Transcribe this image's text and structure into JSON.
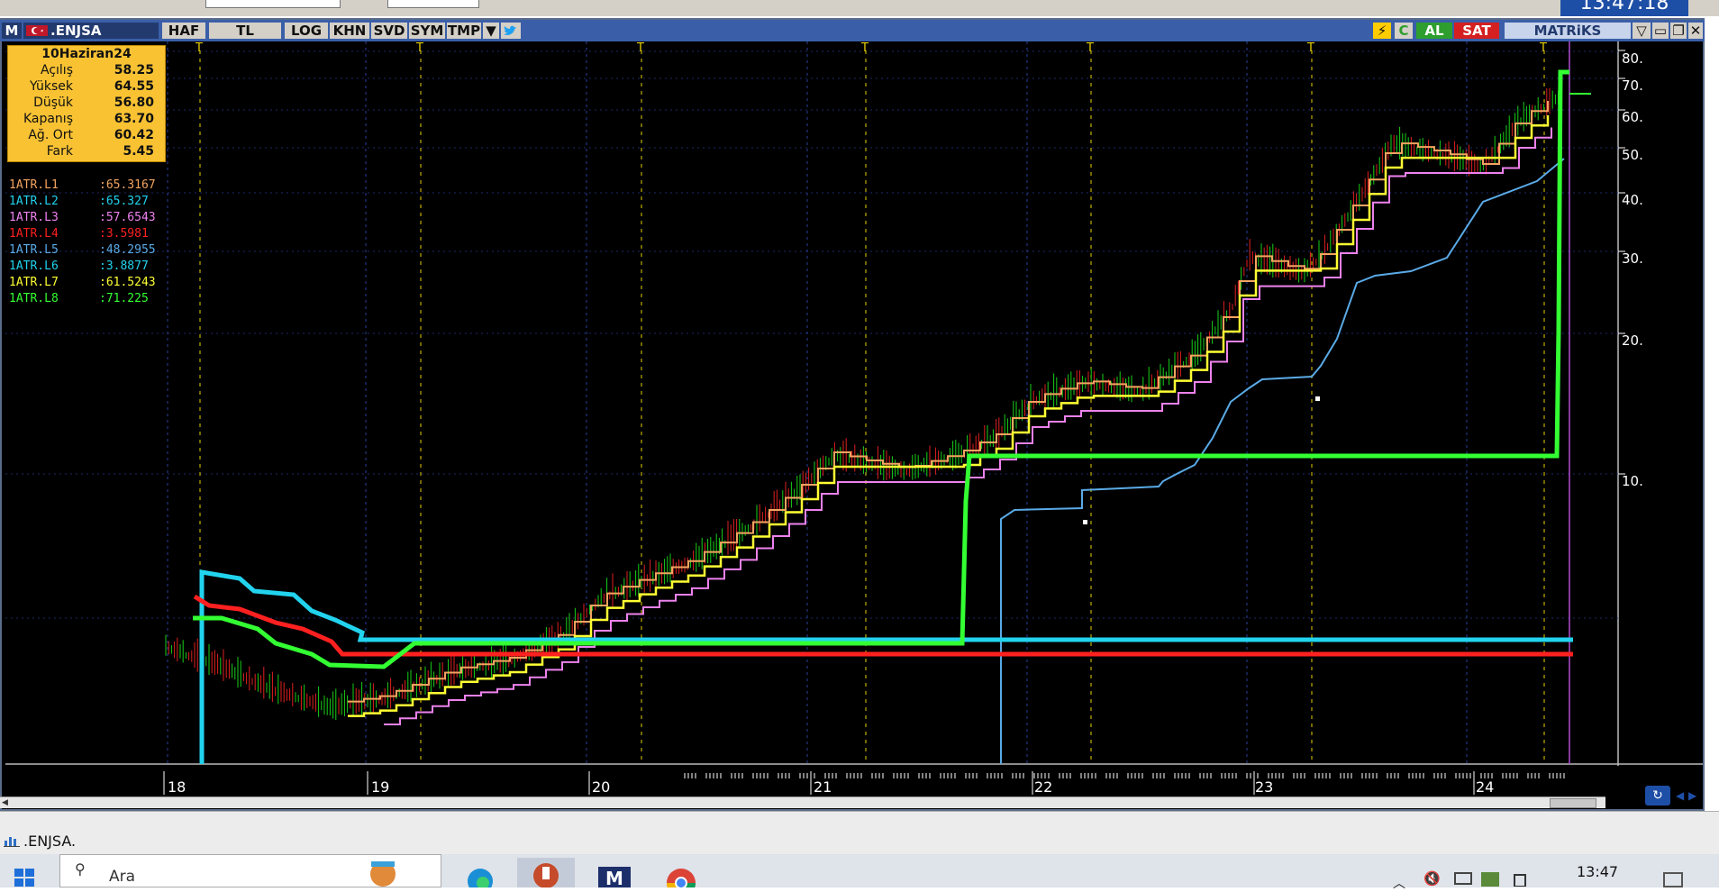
{
  "top_clock": "13:47:18",
  "window": {
    "symbol": ".ENJSA",
    "toolbar": [
      "HAF",
      "TL",
      "LOG",
      "KHN",
      "SVD",
      "SYM",
      "TMP"
    ],
    "al_label": "AL",
    "sat_label": "SAT",
    "brand": "MATRiKS",
    "c_label": "C"
  },
  "ohlc": {
    "date": "10Haziran24",
    "rows": [
      {
        "label": "Açılış",
        "value": "58.25"
      },
      {
        "label": "Yüksek",
        "value": "64.55"
      },
      {
        "label": "Düşük",
        "value": "56.80"
      },
      {
        "label": "Kapanış",
        "value": "63.70"
      },
      {
        "label": "Ağ. Ort",
        "value": "60.42"
      },
      {
        "label": "Fark",
        "value": "5.45"
      }
    ]
  },
  "legend": [
    {
      "name": "1ATR.L1",
      "value": ":65.3167",
      "color": "#f4a460"
    },
    {
      "name": "1ATR.L2",
      "value": ":65.327",
      "color": "#22d3ee"
    },
    {
      "name": "1ATR.L3",
      "value": ":57.6543",
      "color": "#ee82ee"
    },
    {
      "name": "1ATR.L4",
      "value": ":3.5981",
      "color": "#ff2020"
    },
    {
      "name": "1ATR.L5",
      "value": ":48.2955",
      "color": "#5aaae6"
    },
    {
      "name": "1ATR.L6",
      "value": ":3.8877",
      "color": "#22d3ee"
    },
    {
      "name": "1ATR.L7",
      "value": ":61.5243",
      "color": "#ffff33"
    },
    {
      "name": "1ATR.L8",
      "value": ":71.225",
      "color": "#33ff33"
    }
  ],
  "y_axis": [
    "80.",
    "70.",
    "60.",
    "50.",
    "40.",
    "30.",
    "20.",
    "10."
  ],
  "x_axis": [
    "18",
    "19",
    "20",
    "21",
    "22",
    "23",
    "24"
  ],
  "t_marker": "T",
  "status_text": ".ENJSA.",
  "taskbar": {
    "search_placeholder": "Ara",
    "clock": "13:47"
  },
  "colors": {
    "accent_blue": "#3a5fa8",
    "ohlc_bg": "#f8c233",
    "al_green": "#2e9e2e",
    "sat_red": "#d42020"
  }
}
